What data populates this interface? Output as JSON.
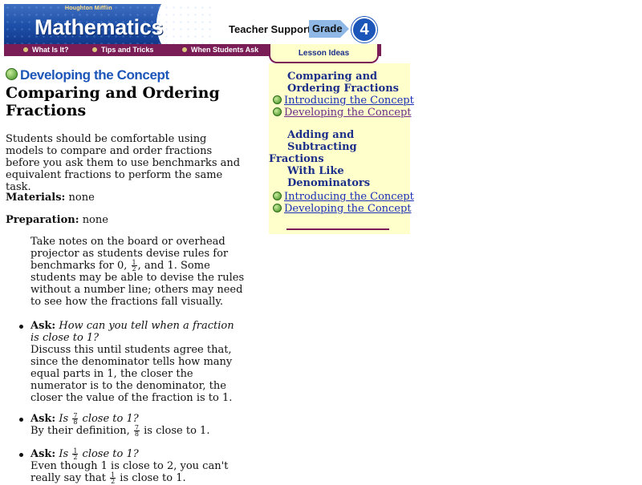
{
  "header": {
    "brand_small": "Houghton Mifflin",
    "brand_title": "Mathematics",
    "teacher_support": "Teacher Support",
    "grade_label": "Grade",
    "grade_number": "4"
  },
  "nav": {
    "items": [
      {
        "label": "What Is It?"
      },
      {
        "label": "Tips and Tricks"
      },
      {
        "label": "When Students Ask"
      }
    ],
    "active_tab": "Lesson Ideas"
  },
  "main": {
    "section_heading": "Developing the Concept",
    "title": "Comparing and Ordering Fractions",
    "intro": "Students should be comfortable using models to compare and order fractions before you ask them to use benchmarks and equivalent fractions to perform the same task.",
    "materials_label": "Materials:",
    "materials_value": "none",
    "preparation_label": "Preparation:",
    "preparation_value": "none",
    "notes_part1": "Take notes on the board or overhead projector as students devise rules for benchmarks for 0,",
    "notes_frac_num": "1",
    "notes_frac_den": "2",
    "notes_part2": ", and 1. Some students may be able to devise the rules without a number line; others may need to see how the fractions fall visually.",
    "ask_label": "Ask:",
    "ask1_question": "How can you tell when a fraction is close to 1?",
    "ask1_answer": "Discuss this until students agree that, since the denominator tells how many equal parts in 1, the closer the numerator is to the denominator, the closer the value of the fraction is to 1.",
    "ask2_q_pre": "Is",
    "ask2_frac_num": "7",
    "ask2_frac_den": "8",
    "ask2_q_post": "close to 1?",
    "ask2_a_pre": "By their definition,",
    "ask2_a_post": "is close to 1.",
    "ask3_q_pre": "Is",
    "ask3_frac_num": "1",
    "ask3_frac_den": "2",
    "ask3_q_post": "close to 1?",
    "ask3_a_pre": "Even though 1 is close to 2, you can't really say that",
    "ask3_a_post": "is close to 1."
  },
  "lesson_ideas": {
    "group1_title": "Comparing and Ordering Fractions",
    "group1_links": [
      "Introducing the Concept",
      "Developing the Concept"
    ],
    "group2_title_line1": "Adding and",
    "group2_title_line2": "Subtracting",
    "group2_title_line3": "Fractions",
    "group2_title_line4": "With Like",
    "group2_title_line5": "Denominators",
    "group2_links": [
      "Introducing the Concept",
      "Developing the Concept"
    ]
  },
  "colors": {
    "nav_bg": "#7a1d57",
    "brand_blue": "#1c56b8",
    "lesson_bg": "#ffffcc",
    "link": "#1a2eb8"
  }
}
